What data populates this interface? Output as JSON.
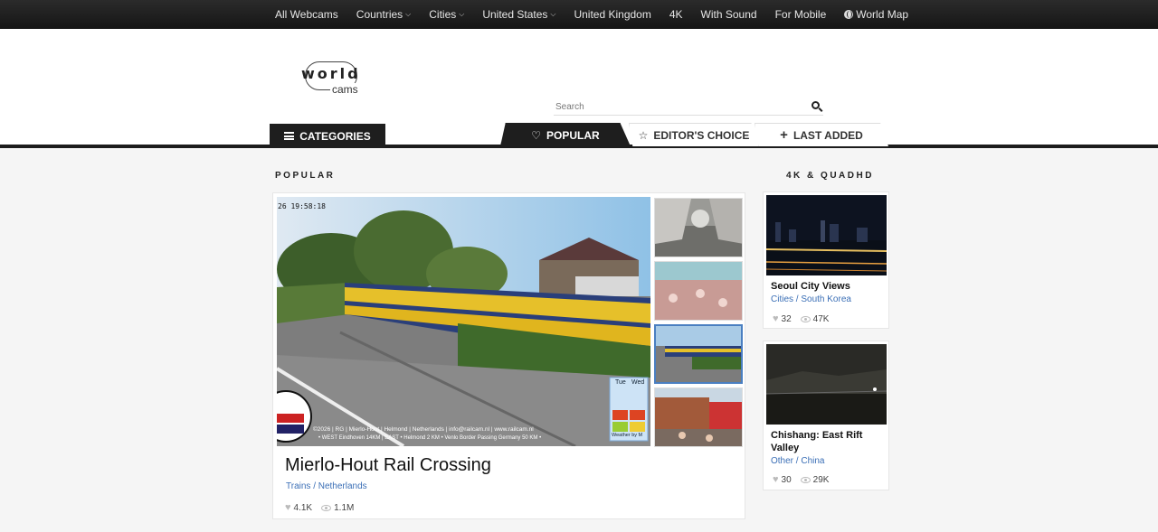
{
  "nav": {
    "items": [
      {
        "label": "All Webcams",
        "dropdown": false
      },
      {
        "label": "Countries",
        "dropdown": true
      },
      {
        "label": "Cities",
        "dropdown": true
      },
      {
        "label": "United States",
        "dropdown": true
      },
      {
        "label": "United Kingdom",
        "dropdown": false
      },
      {
        "label": "4K",
        "dropdown": false
      },
      {
        "label": "With Sound",
        "dropdown": false
      },
      {
        "label": "For Mobile",
        "dropdown": false
      },
      {
        "label": "World Map",
        "dropdown": false,
        "icon": "globe-icon"
      }
    ]
  },
  "logo": {
    "word": "world",
    "sub": "cams"
  },
  "search": {
    "placeholder": "Search"
  },
  "tabs": {
    "categories": "CATEGORIES",
    "popular": "POPULAR",
    "editors_choice": "EDITOR'S CHOICE",
    "last_added": "LAST ADDED"
  },
  "popular": {
    "heading": "POPULAR",
    "featured": {
      "title": "Mierlo-Hout Rail Crossing",
      "category": "Trains / Netherlands",
      "likes": "4.1K",
      "views": "1.1M",
      "overlay_time": "26 19:58:18",
      "overlay_caption": "©2026 | RG | Mierlo-Hout | Helmond | Netherlands | info@railcam.nl | www.railcam.nl",
      "overlay_caption2": "• WEST Eindhoven 14KM | EAST • Helmond 2 KM • Venlo Border Passing Germany 50 KM •",
      "weather_days": [
        "Tue",
        "Wed"
      ],
      "weather_credit": "Weather by M"
    }
  },
  "quad": {
    "heading": "4K & QUADHD",
    "cams": [
      {
        "title": "Seoul City Views",
        "category": "Cities / South Korea",
        "likes": "32",
        "views": "47K"
      },
      {
        "title": "Chishang: East Rift Valley",
        "category": "Other / China",
        "likes": "30",
        "views": "29K"
      }
    ]
  },
  "colors": {
    "accent_link": "#3b6fb6",
    "dark": "#1e1e1e",
    "selected_thumb": "#4a7fc1"
  }
}
